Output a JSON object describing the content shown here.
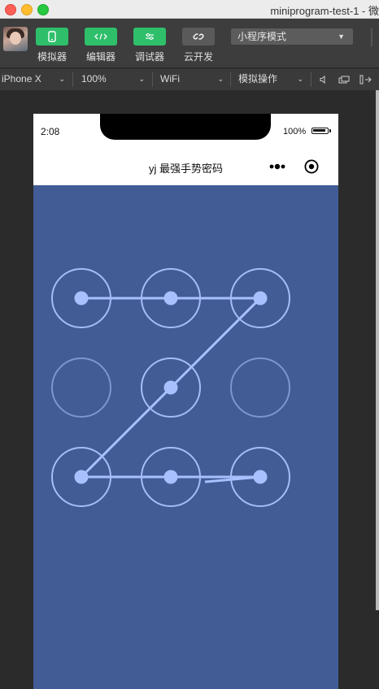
{
  "window": {
    "title": "miniprogram-test-1 - 微"
  },
  "toolbar": {
    "buttons": [
      {
        "label": "模拟器",
        "icon": "phone-icon",
        "active": true
      },
      {
        "label": "编辑器",
        "icon": "code-icon",
        "active": true
      },
      {
        "label": "调试器",
        "icon": "debug-icon",
        "active": true
      },
      {
        "label": "云开发",
        "icon": "cloud-link-icon",
        "active": false
      }
    ],
    "mode_select": "小程序模式"
  },
  "device_bar": {
    "device": "iPhone X",
    "zoom": "100%",
    "network": "WiFi",
    "sim_ops": "模拟操作"
  },
  "phone": {
    "status": {
      "time": "2:08",
      "battery": "100%"
    },
    "nav": {
      "title": "yj 最强手势密码"
    },
    "colors": {
      "background": "#425c96",
      "ring": "#a6bdf6",
      "ring_inactive": "#7e96cc",
      "dot": "#a9c0ff"
    },
    "gesture": {
      "grid": [
        [
          true,
          true,
          true
        ],
        [
          false,
          true,
          false
        ],
        [
          true,
          true,
          true
        ]
      ],
      "path": [
        1,
        2,
        3,
        5,
        7,
        8,
        9
      ]
    }
  }
}
